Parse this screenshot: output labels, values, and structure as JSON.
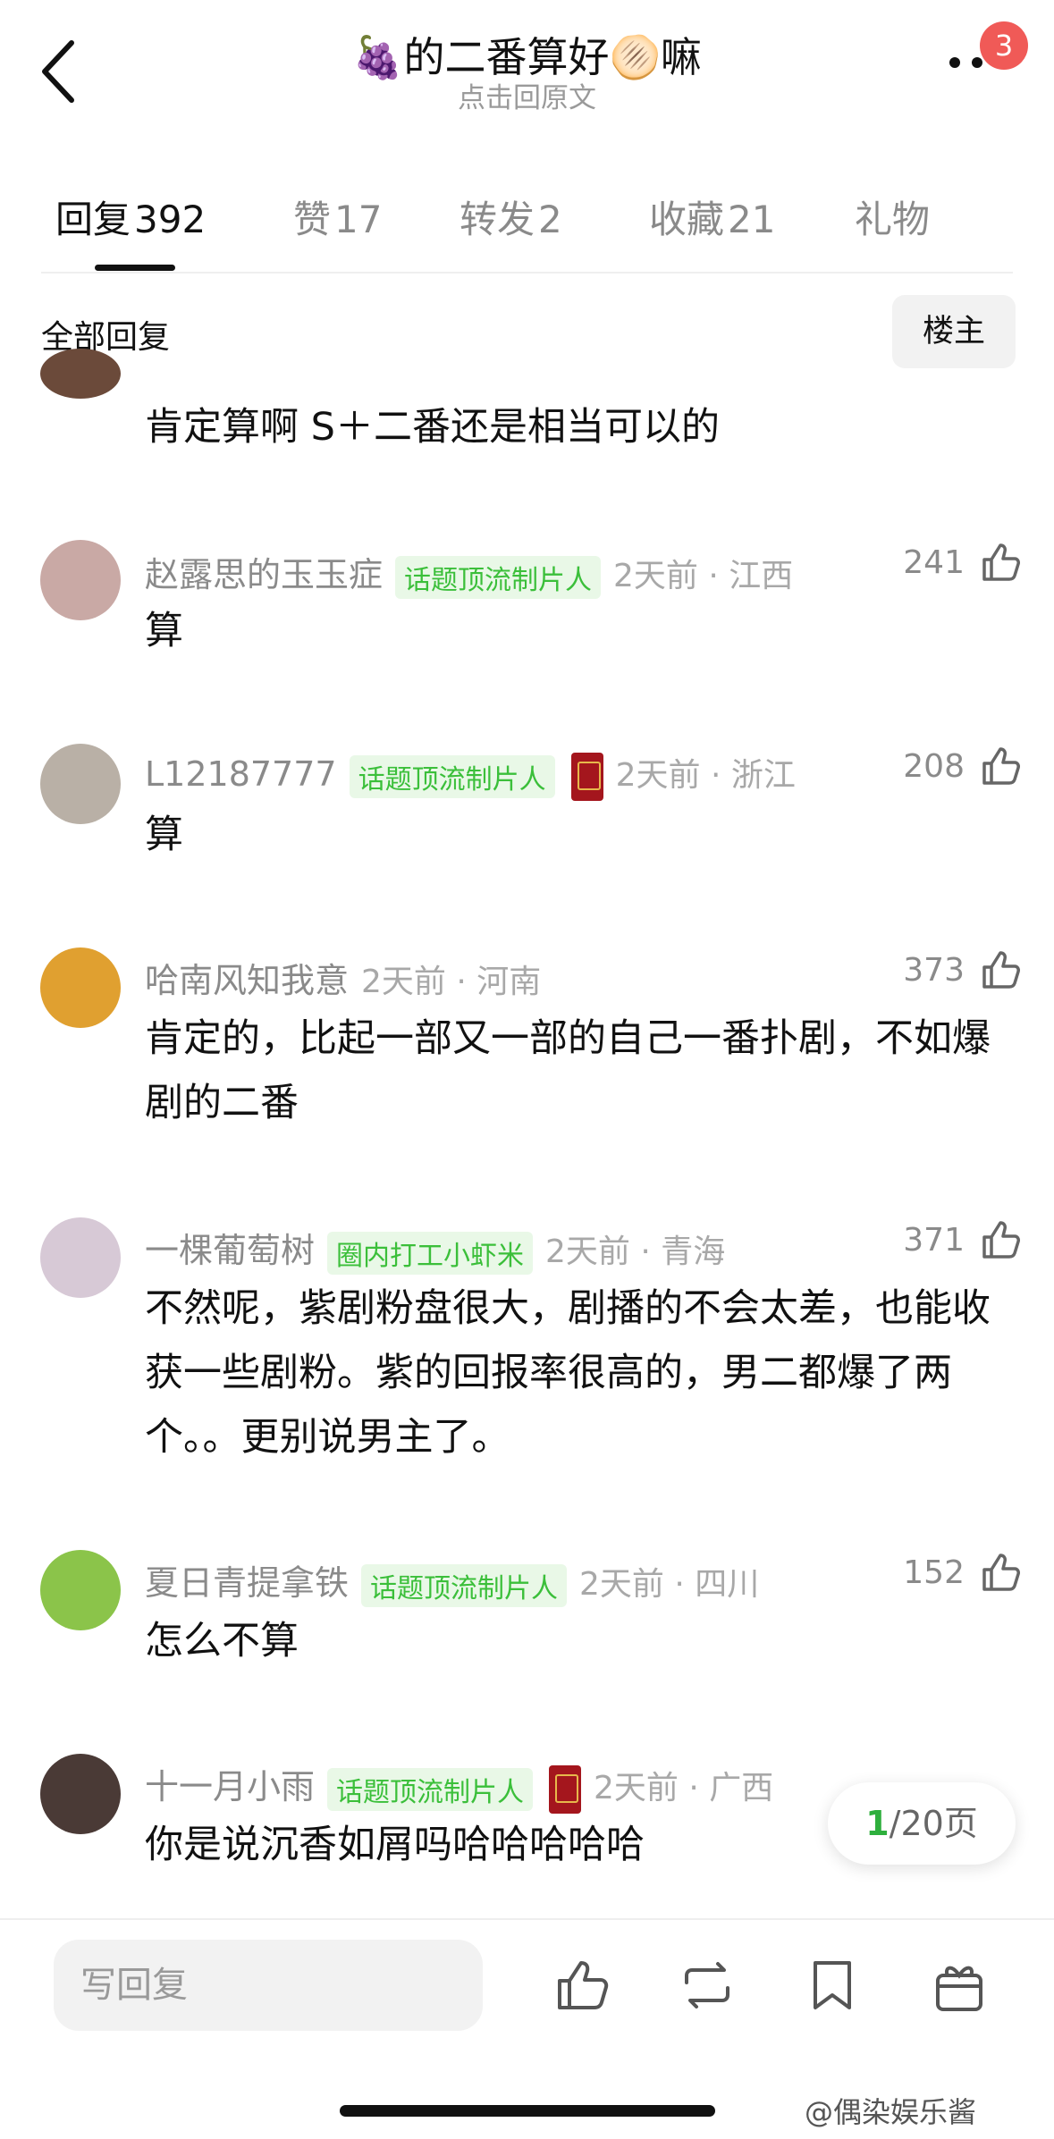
{
  "header": {
    "title": "🍇的二番算好🫓嘛",
    "subtitle": "点击回原文",
    "notification_count": "3"
  },
  "tabs": [
    {
      "label": "回复",
      "count": "392"
    },
    {
      "label": "赞",
      "count": "17"
    },
    {
      "label": "转发",
      "count": "2"
    },
    {
      "label": "收藏",
      "count": "21"
    },
    {
      "label": "礼物",
      "count": ""
    }
  ],
  "section": {
    "all_replies": "全部回复",
    "owner_button": "楼主"
  },
  "comments": [
    {
      "username": "",
      "tag": "",
      "meta": "",
      "likes": "",
      "text": "肯定算啊 S＋二番还是相当可以的",
      "avatar_color": "#6b4a3a"
    },
    {
      "username": "赵露思的玉玉症",
      "tag": "话题顶流制片人",
      "meta": "2天前 · 江西",
      "likes": "241",
      "text": "算",
      "avatar_color": "#c9a9a5"
    },
    {
      "username": "L12187777",
      "tag": "话题顶流制片人",
      "meta": "2天前 · 浙江",
      "likes": "208",
      "text": "算",
      "avatar_color": "#b9b0a6"
    },
    {
      "username": "哈南风知我意",
      "tag": "",
      "meta": "2天前 · 河南",
      "likes": "373",
      "text": "肯定的，比起一部又一部的自己一番扑剧，不如爆剧的二番",
      "avatar_color": "#e0a030"
    },
    {
      "username": "一棵葡萄树",
      "tag": "圈内打工小虾米",
      "meta": "2天前 · 青海",
      "likes": "371",
      "text": "不然呢，紫剧粉盘很大，剧播的不会太差，也能收获一些剧粉。紫的回报率很高的，男二都爆了两个。。更别说男主了。",
      "avatar_color": "#d7c9d6"
    },
    {
      "username": "夏日青提拿铁",
      "tag": "话题顶流制片人",
      "meta": "2天前 · 四川",
      "likes": "152",
      "text": "怎么不算",
      "avatar_color": "#8bc44a"
    },
    {
      "username": "十一月小雨",
      "tag": "话题顶流制片人",
      "meta": "2天前 · 广西",
      "likes": "",
      "text": "你是说沉香如屑吗哈哈哈哈哈",
      "avatar_color": "#4a3a36"
    }
  ],
  "pager": {
    "current": "1",
    "total": "/20页"
  },
  "bottom": {
    "write_placeholder": "写回复"
  },
  "watermark": "@偶染娱乐酱",
  "colors": {
    "accent_green": "#3bbf3a",
    "badge_red": "#f05a57"
  }
}
